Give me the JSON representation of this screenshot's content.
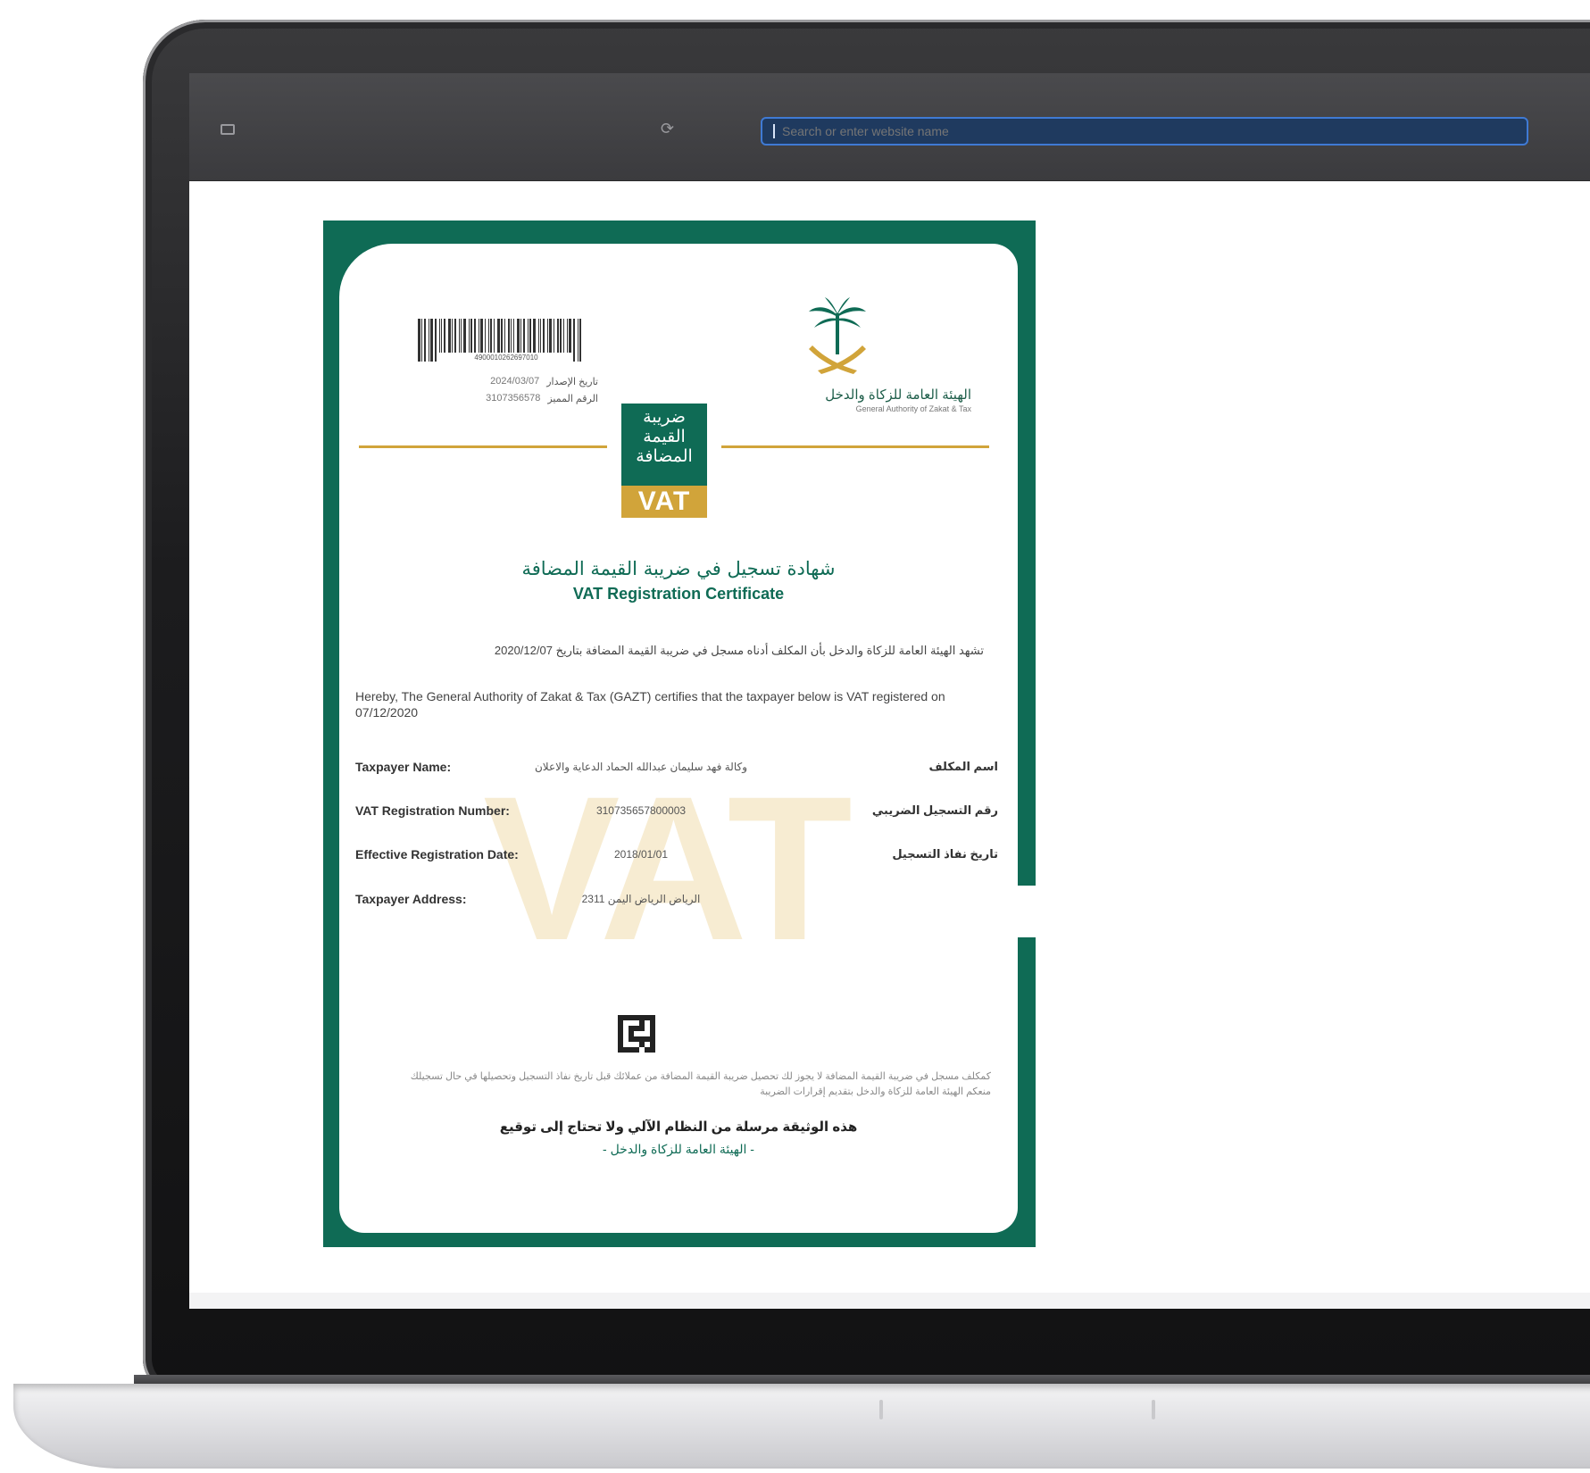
{
  "browser": {
    "address_placeholder": "Search or enter website name"
  },
  "certificate": {
    "barcode_number": "4900010262697010",
    "issue_date_label": "تاريخ الإصدار",
    "issue_date_value": "2024/03/07",
    "reference_label": "الرقم المميز",
    "reference_value": "3107356578",
    "authority_ar": "الهيئة العامة للزكاة والدخل",
    "authority_en": "General Authority of Zakat & Tax",
    "vat_logo_ar": "ضريبة القيمة المضافة",
    "vat_logo_en": "VAT",
    "title_ar": "شهادة تسجيل في ضريبة القيمة المضافة",
    "title_en": "VAT Registration Certificate",
    "body_ar": "تشهد الهيئة العامة للزكاة والدخل بأن المكلف أدناه مسجل في ضريبة القيمة المضافة بتاريخ 2020/12/07",
    "body_en": "Hereby, The General Authority of Zakat & Tax (GAZT) certifies that the taxpayer below is VAT registered on 07/12/2020",
    "watermark": "VAT",
    "fields": [
      {
        "label_en": "Taxpayer Name:",
        "value": "وكالة فهد سليمان عبدالله الحماد الدعاية والاعلان",
        "label_ar": "اسم المكلف"
      },
      {
        "label_en": "VAT Registration Number:",
        "value": "310735657800003",
        "label_ar": "رقم التسجيل الضريبي"
      },
      {
        "label_en": "Effective Registration Date:",
        "value": "2018/01/01",
        "label_ar": "تاريخ نفاذ التسجيل"
      },
      {
        "label_en": "Taxpayer Address:",
        "value": "الرياض الرياض اليمن 2311",
        "label_ar": ""
      }
    ],
    "disclaimer": "كمكلف مسجل في ضريبة القيمة المضافة لا يجوز لك تحصيل ضريبة القيمة المضافة من عملائك قبل تاريخ نفاذ التسجيل وتحصيلها في حال تسجيلك منعكم الهيئة العامة للزكاة والدخل بتقديم إقرارات الضريبة",
    "footer_ar": "هذه الوثيقة مرسلة من النظام الآلي ولا تحتاج إلى توقيع",
    "footer_sub": "- الهيئة العامة للزكاة والدخل -"
  },
  "colors": {
    "brand_green": "#0f6b55",
    "brand_gold": "#d1a43a"
  },
  "icons": {
    "sidebar": "sidebar-icon",
    "reload": "reload-icon",
    "emblem": "palm-swords-emblem-icon",
    "qr": "qr-code-icon"
  }
}
